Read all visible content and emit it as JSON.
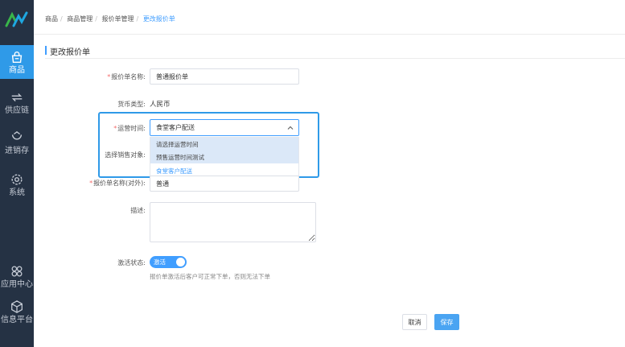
{
  "breadcrumb": [
    "商品",
    "商品管理",
    "报价单管理",
    "更改报价单"
  ],
  "page_title": "更改报价单",
  "sidebar": {
    "items": [
      {
        "label": "商品",
        "icon": "basket-icon",
        "active": true
      },
      {
        "label": "供应链",
        "icon": "exchange-icon",
        "active": false
      },
      {
        "label": "进销存",
        "icon": "box-icon",
        "active": false
      },
      {
        "label": "系统",
        "icon": "gear-icon",
        "active": false
      },
      {
        "label": "应用中心",
        "icon": "apps-icon",
        "active": false
      },
      {
        "label": "信息平台",
        "icon": "cube-icon",
        "active": false
      }
    ]
  },
  "form": {
    "name_label": "报价单名称:",
    "name_value": "普通报价单",
    "currency_label": "货币类型:",
    "currency_value": "人民币",
    "time_label": "运营时间:",
    "time_value": "食堂客户配送",
    "target_label": "选择销售对象:",
    "external_name_label": "报价单名称(对外):",
    "external_name_value": "普通",
    "desc_label": "描述:",
    "status_label": "激活状态:",
    "status_toggle": "激活",
    "status_hint": "报价单激活后客户可正常下单，否则无法下单"
  },
  "dropdown": {
    "options": [
      "请选择运营时间",
      "预售运营时间测试",
      "食堂客户配送"
    ],
    "selected_index": 2
  },
  "buttons": {
    "cancel": "取消",
    "save": "保存"
  },
  "colors": {
    "sidebar_bg": "#253244",
    "accent": "#409eff",
    "active_side": "#2f9ae8",
    "required": "#f56c6c"
  }
}
